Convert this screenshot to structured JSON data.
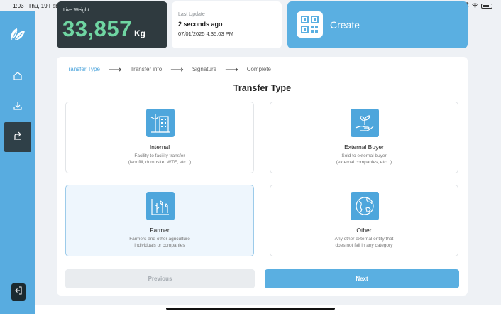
{
  "status_bar": {
    "time": "1:03",
    "date": "Thu, 19 Feb"
  },
  "sidebar": {
    "items": [
      {
        "name": "home",
        "icon": "home-icon",
        "active": false
      },
      {
        "name": "download",
        "icon": "download-icon",
        "active": false
      },
      {
        "name": "transfer",
        "icon": "share-icon",
        "active": true
      }
    ],
    "logout_icon": "logout-icon"
  },
  "weight": {
    "label": "Live Weight",
    "value": "33,857",
    "unit": "Kg"
  },
  "update": {
    "label": "Last Update",
    "value": "2 seconds ago",
    "timestamp": "07/01/2025 4:35:03 PM"
  },
  "create": {
    "label": "Create",
    "icon": "qr-code-icon"
  },
  "stepper": {
    "steps": [
      "Transfer Type",
      "Transfer info",
      "Signature",
      "Complete"
    ],
    "active_index": 0
  },
  "panel": {
    "title": "Transfer Type"
  },
  "options": [
    {
      "title": "Internal",
      "desc1": "Facility to facility transfer",
      "desc2": "(landfill, dumpsite, WTE, etc...)",
      "icon": "building-icon",
      "selected": false
    },
    {
      "title": "External Buyer",
      "desc1": "Sold to external buyer",
      "desc2": "(external companies, etc...)",
      "icon": "hand-plant-icon",
      "selected": false
    },
    {
      "title": "Farmer",
      "desc1": "Farmers and other agriculture",
      "desc2": "individuals or companies",
      "icon": "crops-icon",
      "selected": true
    },
    {
      "title": "Other",
      "desc1": "Any other external entity that",
      "desc2": "does not fall in any category",
      "icon": "globe-icon",
      "selected": false
    }
  ],
  "buttons": {
    "previous": "Previous",
    "next": "Next"
  },
  "colors": {
    "accent": "#5aafe1",
    "weight_green": "#6fd5a2",
    "dark_card": "#2f3a3f"
  }
}
